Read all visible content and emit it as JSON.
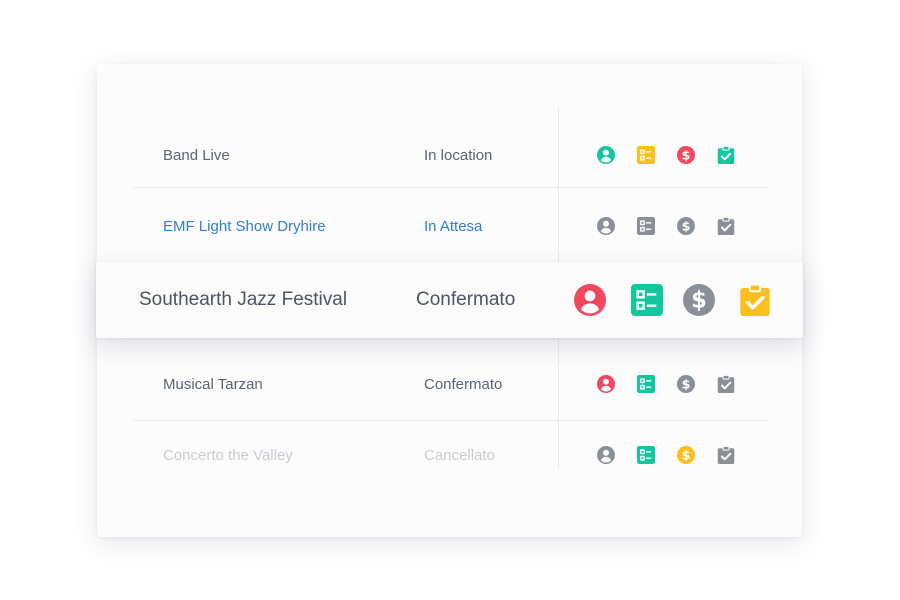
{
  "colors": {
    "teal": "#12c7a0",
    "yellow": "#fbbf1e",
    "red": "#f3465f",
    "gray": "#8b8f97",
    "link_blue": "#2d7ed8"
  },
  "rows": [
    {
      "name": "Band Live",
      "status": "In location",
      "icons": [
        {
          "icon": "user-icon",
          "color": "#12c7a0"
        },
        {
          "icon": "checklist-icon",
          "color": "#fbbf1e"
        },
        {
          "icon": "dollar-icon",
          "color": "#f3465f"
        },
        {
          "icon": "clipboard-check-icon",
          "color": "#12c7a0"
        }
      ]
    },
    {
      "name": "EMF Light Show Dryhire",
      "status": "In Attesa",
      "icons": [
        {
          "icon": "user-icon",
          "color": "#8b8f97"
        },
        {
          "icon": "checklist-icon",
          "color": "#8b8f97"
        },
        {
          "icon": "dollar-icon",
          "color": "#8b8f97"
        },
        {
          "icon": "clipboard-check-icon",
          "color": "#8b8f97"
        }
      ]
    },
    {
      "name": "Southearth Jazz Festival",
      "status": "Confermato",
      "icons": [
        {
          "icon": "user-icon",
          "color": "#f3465f"
        },
        {
          "icon": "checklist-icon",
          "color": "#12c7a0"
        },
        {
          "icon": "dollar-icon",
          "color": "#8b8f97"
        },
        {
          "icon": "clipboard-check-icon",
          "color": "#fbbf1e"
        }
      ]
    },
    {
      "name": "Musical Tarzan",
      "status": "Confermato",
      "icons": [
        {
          "icon": "user-icon",
          "color": "#f3465f"
        },
        {
          "icon": "checklist-icon",
          "color": "#12c7a0"
        },
        {
          "icon": "dollar-icon",
          "color": "#8b8f97"
        },
        {
          "icon": "clipboard-check-icon",
          "color": "#8b8f97"
        }
      ]
    },
    {
      "name": "Concerto the Valley",
      "status": "Cancellato",
      "icons": [
        {
          "icon": "user-icon",
          "color": "#8b8f97"
        },
        {
          "icon": "checklist-icon",
          "color": "#12c7a0"
        },
        {
          "icon": "dollar-icon",
          "color": "#fbbf1e"
        },
        {
          "icon": "clipboard-check-icon",
          "color": "#8b8f97"
        }
      ]
    }
  ]
}
